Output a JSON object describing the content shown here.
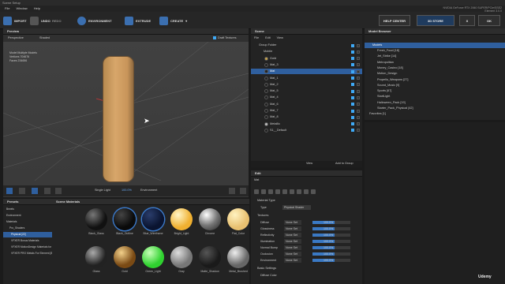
{
  "window": {
    "title": "Scene Setup"
  },
  "menu": [
    "File",
    "Window",
    "Help"
  ],
  "gpu": {
    "line1": "NVIDIA GeForce RTX 2060 SUPER/PCIe/SSE2",
    "line2": "Element 3.0.0"
  },
  "toolbar": {
    "import": "IMPORT",
    "undo": "UNDO",
    "redo": "REDO",
    "environment": "ENVIRONMENT",
    "extrude": "EXTRUDE",
    "create": "CREATE",
    "help_center": "HELP CENTER",
    "store": "3D STORE",
    "close": "X",
    "ok": "OK"
  },
  "viewport": {
    "title": "Preview",
    "camera": "Perspective",
    "shading": "Shaded",
    "draft": "Draft Textures",
    "stats": [
      {
        "k": "Model",
        "v": "Multiple Models"
      },
      {
        "k": "Vertices",
        "v": "704676"
      },
      {
        "k": "Faces",
        "v": "234656"
      }
    ],
    "light": "Single Light",
    "light_val": "100.0%",
    "env": "Environment"
  },
  "scene": {
    "title": "Scene",
    "menu": [
      "File",
      "Edit",
      "View"
    ],
    "items": [
      "Group Folder",
      "Mobile",
      "Gold",
      "Mat_3",
      "Mat",
      "Mat_1",
      "Mat_2",
      "Mat_5",
      "Mat_4",
      "Mat_6",
      "Mat_7",
      "Mat_8",
      "Metallic",
      "S1__Default"
    ],
    "view": "View",
    "add_group": "Add to Group"
  },
  "edit": {
    "title": "Edit",
    "material": "Mat",
    "type_label": "Material Type",
    "type_key": "Type",
    "type_val": "Physical Shader",
    "textures_hdr": "Textures",
    "props": [
      {
        "k": "Diffuse",
        "v": "100.0%",
        "f": 1.0
      },
      {
        "k": "Glossiness",
        "v": "100.0%",
        "f": 1.0
      },
      {
        "k": "Reflectivity",
        "v": "100.0%",
        "f": 1.0
      },
      {
        "k": "Illumination",
        "v": "100.0%",
        "f": 1.0
      },
      {
        "k": "Normal Bump",
        "v": "100.0%",
        "f": 1.0
      },
      {
        "k": "Occlusion",
        "v": "100.0%",
        "f": 1.0
      },
      {
        "k": "Environment",
        "v": "100.0%",
        "f": 1.0
      }
    ],
    "none_set": "None Set",
    "basic": "Basic Settings",
    "diffuse_color": "Diffuse Color"
  },
  "browser": {
    "title": "Model Browser",
    "root": "Models",
    "items": [
      "Fresh_Food [18]",
      "Jet_Strike [14]",
      "Metropolitan",
      "Money_Casino [18]",
      "Motion_Design",
      "Propello_Weapons [27]",
      "Sound_Music [9]",
      "Sports [67]",
      "StartLight",
      "Halloween_Pack [19]",
      "Starter_Pack_Physical [42]",
      "Favorites [1]"
    ]
  },
  "presets": {
    "title": "Presets",
    "items": [
      "Bevels",
      "Environment",
      "Materials",
      "Pro_Shaders",
      "Physical [22]",
      "VFXER Bonus Materials",
      "VFXER MotionDesign Materials for Element",
      "VFXER PRO Metals For Element [8]"
    ]
  },
  "scenemat": {
    "title": "Scene Materials",
    "row1": [
      "Black_Glass",
      "Black_Outline",
      "Blue_Wireframe",
      "Bright_Light",
      "Chrome",
      "Flat_Color"
    ],
    "row2": [
      "Glass",
      "Gold",
      "Green_Light",
      "Gray",
      "Matte_Shadow",
      "Metal_Brushed"
    ]
  },
  "watermark": "Udemy"
}
